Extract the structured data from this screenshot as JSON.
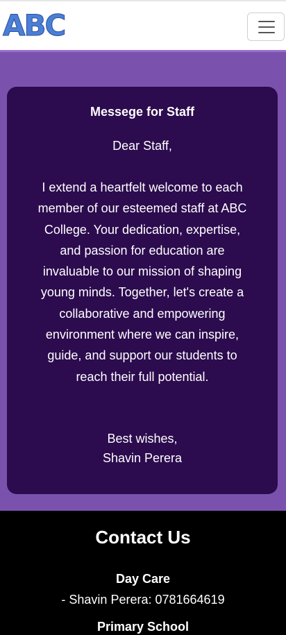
{
  "navbar": {
    "logo_text": "ABC",
    "toggle_icon": "hamburger-menu-icon"
  },
  "colors": {
    "logo_fill": "#4a7fd6",
    "section_background": "#7a52ae",
    "card_background": "#2c0b4e",
    "footer_background": "#000000"
  },
  "message": {
    "title": "Messege for Staff",
    "greeting": "Dear Staff,",
    "body": "I extend a heartfelt welcome to each member of our esteemed staff at ABC College. Your dedication, expertise, and passion for education are invaluable to our mission of shaping young minds. Together, let's create a collaborative and empowering environment where we can inspire, guide, and support our students to reach their full potential.",
    "closing": "Best wishes,",
    "signature": "Shavin Perera"
  },
  "contact": {
    "title": "Contact Us",
    "groups": [
      {
        "name": "Day Care",
        "line": "- Shavin Perera: 0781664619"
      },
      {
        "name": "Primary School"
      }
    ]
  }
}
